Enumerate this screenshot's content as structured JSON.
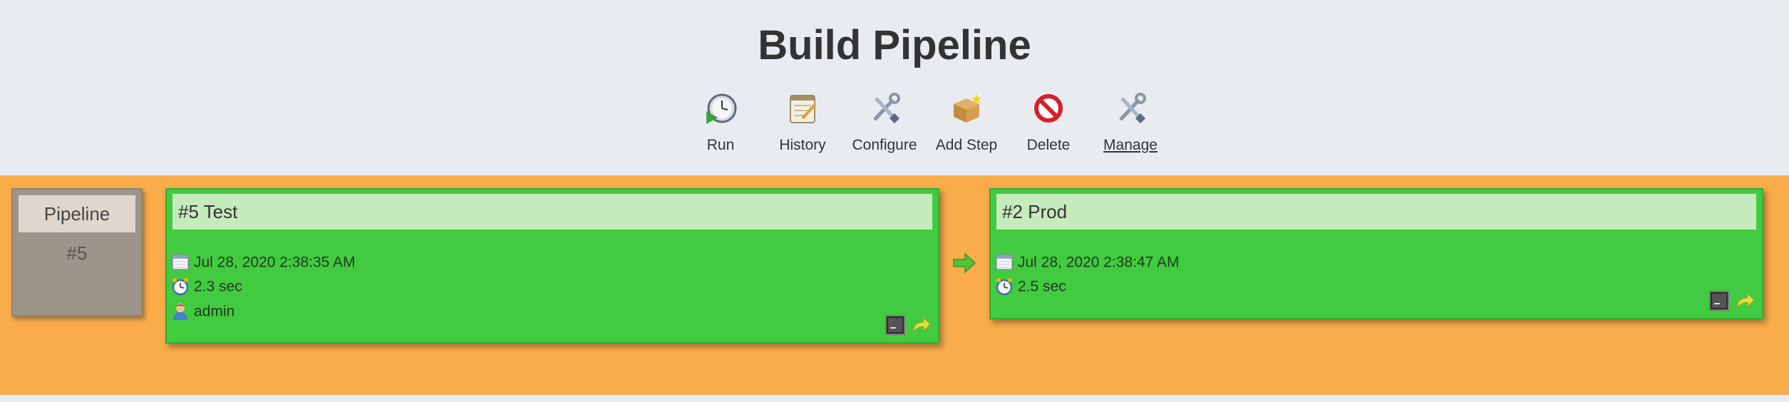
{
  "page": {
    "title": "Build Pipeline"
  },
  "toolbar": {
    "items": [
      {
        "label": "Run",
        "icon": "run-clock-icon"
      },
      {
        "label": "History",
        "icon": "notepad-icon"
      },
      {
        "label": "Configure",
        "icon": "tools-icon"
      },
      {
        "label": "Add Step",
        "icon": "package-icon"
      },
      {
        "label": "Delete",
        "icon": "no-entry-icon"
      },
      {
        "label": "Manage",
        "icon": "tools-icon"
      }
    ]
  },
  "pipeline": {
    "label": "Pipeline",
    "number": "#5"
  },
  "builds": [
    {
      "title": "#5 Test",
      "date": "Jul 28, 2020 2:38:35 AM",
      "duration": "2.3 sec",
      "user": "admin",
      "status_color": "#42cb41"
    },
    {
      "title": "#2 Prod",
      "date": "Jul 28, 2020 2:38:47 AM",
      "duration": "2.5 sec",
      "status_color": "#42cb41"
    }
  ],
  "colors": {
    "stage_bg": "#f8ac4a",
    "success": "#42cb41",
    "header_bg": "#e8ecf1"
  }
}
